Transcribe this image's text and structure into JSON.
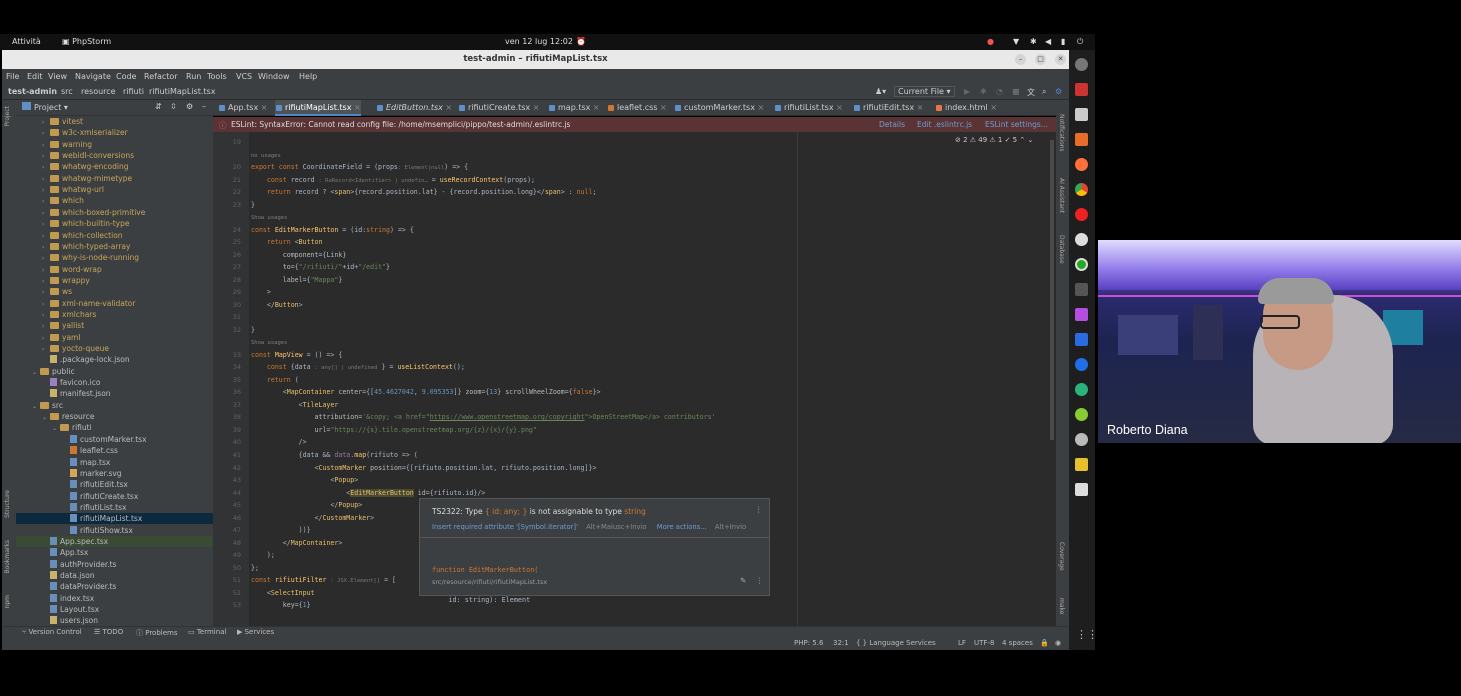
{
  "system": {
    "activities": "Attività",
    "app": "PhpStorm",
    "clock": "ven 12 lug  12:02"
  },
  "window": {
    "title": "test-admin – rifiutiMapList.tsx"
  },
  "menu": [
    "File",
    "Edit",
    "View",
    "Navigate",
    "Code",
    "Refactor",
    "Run",
    "Tools",
    "VCS",
    "Window",
    "Help"
  ],
  "breadcrumb": [
    "test-admin",
    "src",
    "resource",
    "rifiuti",
    "rifiutiMapList.tsx"
  ],
  "nav_right": {
    "run_config": "Current File ▾"
  },
  "project": {
    "title": "Project ▾"
  },
  "tree": [
    {
      "label": "vitest",
      "type": "folder",
      "indent": 2,
      "arrow": "›"
    },
    {
      "label": "w3c-xmlserializer",
      "type": "folder",
      "indent": 2,
      "arrow": "›"
    },
    {
      "label": "warning",
      "type": "folder",
      "indent": 2,
      "arrow": "›"
    },
    {
      "label": "webidl-conversions",
      "type": "folder",
      "indent": 2,
      "arrow": "›"
    },
    {
      "label": "whatwg-encoding",
      "type": "folder",
      "indent": 2,
      "arrow": "›"
    },
    {
      "label": "whatwg-mimetype",
      "type": "folder",
      "indent": 2,
      "arrow": "›"
    },
    {
      "label": "whatwg-url",
      "type": "folder",
      "indent": 2,
      "arrow": "›"
    },
    {
      "label": "which",
      "type": "folder",
      "indent": 2,
      "arrow": "›"
    },
    {
      "label": "which-boxed-primitive",
      "type": "folder",
      "indent": 2,
      "arrow": "›"
    },
    {
      "label": "which-builtin-type",
      "type": "folder",
      "indent": 2,
      "arrow": "›"
    },
    {
      "label": "which-collection",
      "type": "folder",
      "indent": 2,
      "arrow": "›"
    },
    {
      "label": "which-typed-array",
      "type": "folder",
      "indent": 2,
      "arrow": "›"
    },
    {
      "label": "why-is-node-running",
      "type": "folder",
      "indent": 2,
      "arrow": "›"
    },
    {
      "label": "word-wrap",
      "type": "folder",
      "indent": 2,
      "arrow": "›"
    },
    {
      "label": "wrappy",
      "type": "folder",
      "indent": 2,
      "arrow": "›"
    },
    {
      "label": "ws",
      "type": "folder",
      "indent": 2,
      "arrow": "›"
    },
    {
      "label": "xml-name-validator",
      "type": "folder",
      "indent": 2,
      "arrow": "›"
    },
    {
      "label": "xmlchars",
      "type": "folder",
      "indent": 2,
      "arrow": "›"
    },
    {
      "label": "yallist",
      "type": "folder",
      "indent": 2,
      "arrow": "›"
    },
    {
      "label": "yaml",
      "type": "folder",
      "indent": 2,
      "arrow": "›"
    },
    {
      "label": "yocto-queue",
      "type": "folder",
      "indent": 2,
      "arrow": "›"
    },
    {
      "label": ".package-lock.json",
      "type": "json",
      "indent": 2,
      "arrow": ""
    },
    {
      "label": "public",
      "type": "folder",
      "indent": 1,
      "arrow": "⌄"
    },
    {
      "label": "favicon.ico",
      "type": "ico",
      "indent": 2,
      "arrow": ""
    },
    {
      "label": "manifest.json",
      "type": "json",
      "indent": 2,
      "arrow": ""
    },
    {
      "label": "src",
      "type": "folder",
      "indent": 1,
      "arrow": "⌄"
    },
    {
      "label": "resource",
      "type": "folder",
      "indent": 2,
      "arrow": "⌄"
    },
    {
      "label": "rifiuti",
      "type": "folder",
      "indent": 3,
      "arrow": "⌄"
    },
    {
      "label": "customMarker.tsx",
      "type": "tsx",
      "indent": 4,
      "arrow": ""
    },
    {
      "label": "leaflet.css",
      "type": "css",
      "indent": 4,
      "arrow": ""
    },
    {
      "label": "map.tsx",
      "type": "tsx",
      "indent": 4,
      "arrow": ""
    },
    {
      "label": "marker.svg",
      "type": "svg",
      "indent": 4,
      "arrow": ""
    },
    {
      "label": "rifiutiEdit.tsx",
      "type": "tsx",
      "indent": 4,
      "arrow": ""
    },
    {
      "label": "rifiutiCreate.tsx",
      "type": "tsx",
      "indent": 4,
      "arrow": ""
    },
    {
      "label": "rifiutiList.tsx",
      "type": "tsx",
      "indent": 4,
      "arrow": ""
    },
    {
      "label": "rifiutiMapList.tsx",
      "type": "tsx",
      "indent": 4,
      "arrow": "",
      "selected": true
    },
    {
      "label": "rifiutiShow.tsx",
      "type": "tsx",
      "indent": 4,
      "arrow": ""
    },
    {
      "label": "App.spec.tsx",
      "type": "tsx",
      "indent": 2,
      "arrow": "",
      "hl": true
    },
    {
      "label": "App.tsx",
      "type": "tsx",
      "indent": 2,
      "arrow": ""
    },
    {
      "label": "authProvider.ts",
      "type": "tsx",
      "indent": 2,
      "arrow": ""
    },
    {
      "label": "data.json",
      "type": "json",
      "indent": 2,
      "arrow": ""
    },
    {
      "label": "dataProvider.ts",
      "type": "tsx",
      "indent": 2,
      "arrow": ""
    },
    {
      "label": "index.tsx",
      "type": "tsx",
      "indent": 2,
      "arrow": ""
    },
    {
      "label": "Layout.tsx",
      "type": "tsx",
      "indent": 2,
      "arrow": ""
    },
    {
      "label": "users.json",
      "type": "json",
      "indent": 2,
      "arrow": ""
    }
  ],
  "tabs": [
    {
      "label": "App.tsx",
      "kind": "tsx"
    },
    {
      "label": "rifiutiMapList.tsx",
      "kind": "tsx",
      "active": true
    },
    {
      "label": "EditButton.tsx",
      "kind": "tsx",
      "italic": true
    },
    {
      "label": "rifiutiCreate.tsx",
      "kind": "tsx"
    },
    {
      "label": "map.tsx",
      "kind": "tsx"
    },
    {
      "label": "leaflet.css",
      "kind": "css"
    },
    {
      "label": "customMarker.tsx",
      "kind": "tsx"
    },
    {
      "label": "rifiutiList.tsx",
      "kind": "tsx"
    },
    {
      "label": "rifiutiEdit.tsx",
      "kind": "tsx"
    },
    {
      "label": "index.html",
      "kind": "html"
    }
  ],
  "eslint": {
    "message": "ESLint: SyntaxError: Cannot read config file: /home/msemplici/pippo/test-admin/.eslintrc.js",
    "details": "Details",
    "edit": "Edit .eslintrc.js",
    "settings": "ESLint settings..."
  },
  "inspections": "⊘ 2  ⚠ 49  ⚠ 1  ✓ 5  ⌃ ⌄",
  "code_lines": [
    {
      "n": "19",
      "html": ""
    },
    {
      "n": "",
      "html": "<span class='usage'>no usages</span>"
    },
    {
      "n": "20",
      "html": "<span class='kw'>export const</span> CoordinateField = (props<span class='hint'>: Element|null</span>) =&gt; {"
    },
    {
      "n": "21",
      "html": "    <span class='kw'>const</span> record <span class='hint'>: RaRecord&lt;Identifier&gt; | undefin…</span> = <span class='fn'>useRecordContext</span>(props);"
    },
    {
      "n": "22",
      "html": "    <span class='kw'>return</span> record ? &lt;<span class='tag'>span</span>&gt;{record.position.lat} - {record.position.long}&lt;/<span class='tag'>span</span>&gt; : <span class='kw'>null</span>;"
    },
    {
      "n": "23",
      "html": "}"
    },
    {
      "n": "",
      "html": "<span class='usage'>Show usages</span>"
    },
    {
      "n": "24",
      "html": "<span class='kw'>const</span> <span class='fn'>EditMarkerButton</span> = (id:<span class='kw'>string</span>) =&gt; {"
    },
    {
      "n": "25",
      "html": "    <span class='kw'>return</span> &lt;<span class='tag'>Button</span>"
    },
    {
      "n": "26",
      "html": "        <span class='at'>component</span>={Link}"
    },
    {
      "n": "27",
      "html": "        <span class='at'>to</span>={<span class='str'>\"/rifiuti/\"</span>+id+<span class='str'>\"/edit\"</span>}"
    },
    {
      "n": "28",
      "html": "        <span class='at'>label</span>={<span class='str'>\"Mappa\"</span>}"
    },
    {
      "n": "29",
      "html": "    &gt;"
    },
    {
      "n": "30",
      "html": "    &lt;/<span class='tag'>Button</span>&gt;"
    },
    {
      "n": "31",
      "html": ""
    },
    {
      "n": "32",
      "html": "}"
    },
    {
      "n": "",
      "html": "<span class='usage'>Show usages</span>"
    },
    {
      "n": "33",
      "html": "<span class='kw'>const</span> <span class='fn'>MapView</span> = () =&gt; {"
    },
    {
      "n": "34",
      "html": "    <span class='kw'>const</span> {data <span class='hint'>: any[] | undefined</span> } = <span class='fn'>useListContext</span>();"
    },
    {
      "n": "35",
      "html": "    <span class='kw'>return</span> ("
    },
    {
      "n": "36",
      "html": "        &lt;<span class='tag'>MapContainer</span> <span class='at'>center</span>={[<span class='num'>45.4627042</span>, <span class='num'>9.095353</span>]} <span class='at'>zoom</span>={<span class='num'>13</span>} <span class='at'>scrollWheelZoom</span>={<span class='kw'>false</span>}&gt;"
    },
    {
      "n": "37",
      "html": "            &lt;<span class='tag'>TileLayer</span>"
    },
    {
      "n": "38",
      "html": "                <span class='at'>attribution</span>=<span class='str'>'&amp;copy; &lt;a href=\"<u>https://www.openstreetmap.org/copyright</u>\"&gt;OpenStreetMap&lt;/a&gt; contributors'</span>"
    },
    {
      "n": "39",
      "html": "                <span class='at'>url</span>=<span class='str'>\"https://{s}.tile.openstreetmap.org/{z}/{x}/{y}.png\"</span>"
    },
    {
      "n": "40",
      "html": "            /&gt;"
    },
    {
      "n": "41",
      "html": "            {data &amp;&amp; <span class='var'>data</span>.<span class='fn'>map</span>(rifiuto =&gt; ("
    },
    {
      "n": "42",
      "html": "                &lt;<span class='tag'>CustomMarker</span> <span class='at'>position</span>={[rifiuto.position.lat, rifiuto.position.long]}&gt;"
    },
    {
      "n": "43",
      "html": "                    &lt;<span class='tag'>Popup</span>&gt;"
    },
    {
      "n": "44",
      "html": "                        &lt;<span class='tag' style='background:#4a4a30'>EditMarkerButton</span> <span class='at'>id</span>={rifiuto.id}/&gt;"
    },
    {
      "n": "45",
      "html": "                    &lt;/<span class='tag'>Popup</span>&gt;"
    },
    {
      "n": "46",
      "html": "                &lt;/<span class='tag'>CustomMarker</span>&gt;"
    },
    {
      "n": "47",
      "html": "            ))}"
    },
    {
      "n": "48",
      "html": "        &lt;/<span class='tag'>MapContainer</span>&gt;"
    },
    {
      "n": "49",
      "html": "    );"
    },
    {
      "n": "50",
      "html": "};"
    },
    {
      "n": "51",
      "html": "<span class='kw'>const</span> <span class='fn'>rifiutiFilter</span> <span class='hint'>: JSX.Element[]</span> = ["
    },
    {
      "n": "52",
      "html": "    &lt;<span class='tag'>SelectInput</span>"
    },
    {
      "n": "53",
      "html": "        <span class='at'>key</span>={<span class='num'>1</span>}"
    }
  ],
  "popup": {
    "error_code": "TS2322: Type ",
    "error_type": "{ id: any; }",
    "error_mid": " is not assignable to type ",
    "error_target": "string",
    "action1": "Insert required attribute '[Symbol.iterator]'",
    "action1_key": "Alt+Maiusc+Invio",
    "action2": "More actions...",
    "action2_key": "Alt+Invio",
    "sig1": "function EditMarkerButton(",
    "sig2": "    id: string): Element",
    "path": "src/resource/rifiuti/rifiutiMapList.tsx"
  },
  "bottom_tools": [
    "Version Control",
    "TODO",
    "Problems",
    "Terminal",
    "Services"
  ],
  "status": {
    "php": "PHP: 5.6",
    "pos": "32:1",
    "lang": "Language Services",
    "lf": "LF",
    "enc": "UTF-8",
    "indent": "4 spaces"
  },
  "left_strip": [
    "Project",
    "Structure",
    "Bookmarks",
    "npm"
  ],
  "right_strip": [
    "Notifications",
    "AI Assistant",
    "Database",
    "Coverage",
    "make"
  ],
  "webcam": {
    "name": "Roberto Diana"
  }
}
